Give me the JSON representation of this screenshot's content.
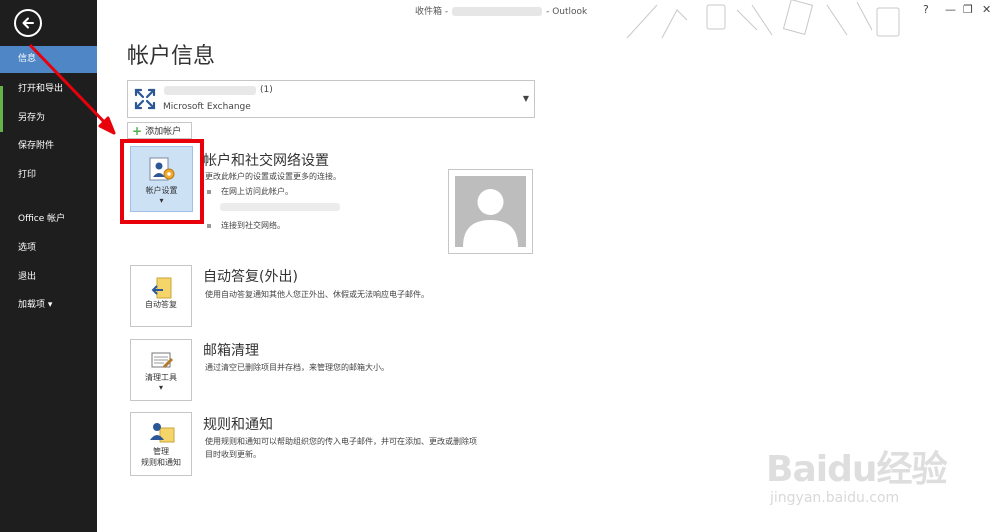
{
  "window": {
    "title_prefix": "收件箱 -",
    "title_suffix": "- Outlook",
    "controls": [
      "?",
      "—",
      "❐",
      "✕"
    ]
  },
  "sidebar": {
    "back_icon": "back-arrow-icon",
    "items": [
      {
        "label": "信息",
        "active": true
      },
      {
        "label": "打开和导出"
      },
      {
        "label": "另存为"
      },
      {
        "label": "保存附件"
      },
      {
        "label": "打印"
      },
      {
        "label": "Office 帐户"
      },
      {
        "label": "选项"
      },
      {
        "label": "退出"
      },
      {
        "label": "加载项 ▾"
      }
    ]
  },
  "main": {
    "page_title": "帐户信息",
    "account": {
      "count": "(1)",
      "type": "Microsoft Exchange"
    },
    "add_account_label": "添加帐户",
    "sections": [
      {
        "button_label": "帐户设置",
        "button_sub": "▾",
        "title": "帐户和社交网络设置",
        "desc": "更改此帐户的设置或设置更多的连接。",
        "bullets": [
          "在网上访问此帐户。",
          "连接到社交网络。"
        ]
      },
      {
        "button_label": "自动答复",
        "title": "自动答复(外出)",
        "desc": "使用自动答复通知其他人您正外出、休假或无法响应电子邮件。"
      },
      {
        "button_label": "清理工具",
        "button_sub": "▾",
        "title": "邮箱清理",
        "desc": "通过清空已删除项目并存档，来管理您的邮箱大小。"
      },
      {
        "button_label_1": "管理",
        "button_label_2": "规则和通知",
        "title": "规则和通知",
        "desc_1": "使用规则和通知可以帮助组织您的传入电子邮件，并可在添加、更改或删除项",
        "desc_2": "目时收到更新。"
      }
    ]
  },
  "watermark": {
    "main": "Baidu经验",
    "sub": "jingyan.baidu.com"
  },
  "colors": {
    "sidebar_bg": "#1e1e1e",
    "active_item": "#4f86c6",
    "highlight_red": "#e8000b",
    "annotation_arrow": "#e8000b"
  }
}
